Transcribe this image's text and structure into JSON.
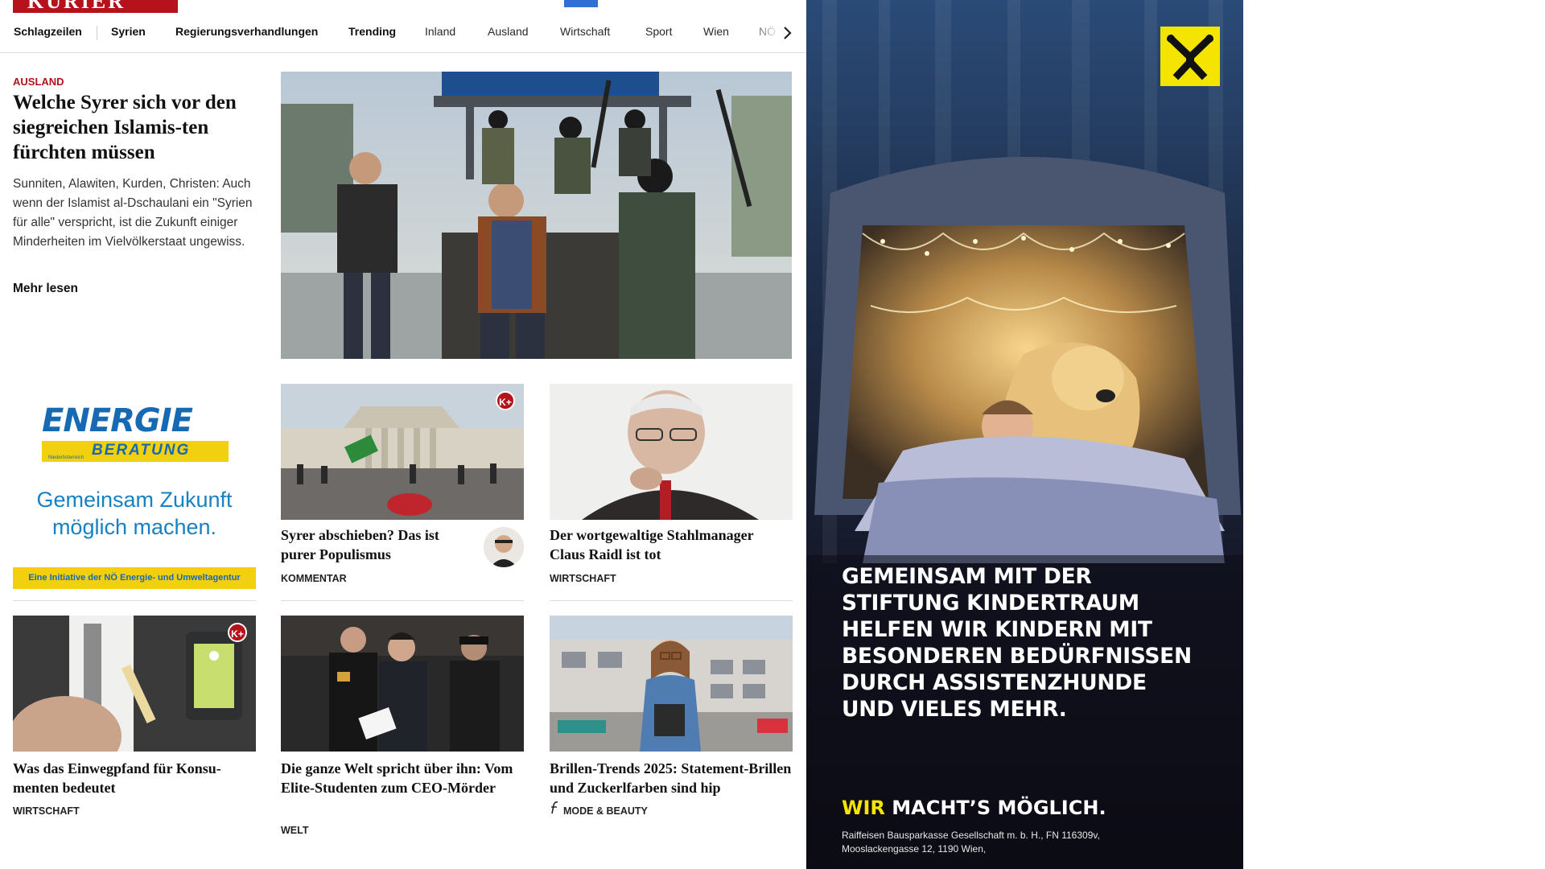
{
  "header": {
    "logo_text": "KURIER",
    "nav": [
      {
        "label": "Schlagzeilen"
      },
      {
        "label": "Syrien"
      },
      {
        "label": "Regierungsverhandlungen"
      },
      {
        "label": "Trending"
      },
      {
        "label": "Inland"
      },
      {
        "label": "Ausland"
      },
      {
        "label": "Wirtschaft"
      },
      {
        "label": "Sport"
      },
      {
        "label": "Wien"
      },
      {
        "label": "NÖ"
      }
    ]
  },
  "lead": {
    "kicker": "AUSLAND",
    "title": "Welche Syrer sich vor den siegreichen Islamis-ten fürchten müssen",
    "teaser": "Sunniten, Alawiten, Kurden, Christen: Auch wenn der Islamist al-Dschaulani ein \"Syrien für alle\" verspricht, ist die Zukunft einiger Minderheiten im Vielvölkerstaat ungewiss.",
    "more": "Mehr lesen"
  },
  "ad_left": {
    "brand": "ENERGIE",
    "brand_sub": "BERATUNG",
    "brand_tiny": "Niederösterreich",
    "slogan_line1": "Gemeinsam Zukunft",
    "slogan_line2": "möglich machen.",
    "band": "Eine Initiative der NÖ Energie- und Umweltagentur"
  },
  "cards": [
    {
      "title": "Syrer abschieben? Das ist purer Populismus",
      "category": "KOMMENTAR",
      "badge": "K+"
    },
    {
      "title": "Der wortgewaltige Stahlmanager Claus Raidl ist tot",
      "category": "WIRTSCHAFT"
    },
    {
      "title": "Was das Einwegpfand für Konsu-menten bedeutet",
      "category": "WIRTSCHAFT",
      "badge": "K+"
    },
    {
      "title": "Die ganze Welt spricht über ihn: Vom Elite-Studenten zum CEO-Mörder",
      "category": "WELT"
    },
    {
      "title": "Brillen-Trends 2025: Statement-Brillen und Zuckerlfarben sind hip",
      "category": "MODE & BEAUTY",
      "icon": "fashion-f-icon"
    }
  ],
  "ad_right": {
    "headline": [
      "GEMEINSAM MIT DER",
      "STIFTUNG KINDERTRAUM",
      "HELFEN WIR KINDERN MIT",
      "BESONDEREN BEDÜRFNISSEN",
      "DURCH ASSISTENZHUNDE",
      "UND VIELES MEHR."
    ],
    "claim_highlight": "WIR",
    "claim_rest": " MACHT’S MÖGLICH.",
    "legal_line1": "Raiffeisen Bausparkasse Gesellschaft m. b. H., FN 116309v,",
    "legal_line2": "Mooslackengasse 12, 1190 Wien,",
    "logo_icon": "raiffeisen-gable-icon"
  },
  "colors": {
    "brand_red": "#b5121b",
    "nav_text": "#2a2a2a",
    "ad_yellow": "#f4e400",
    "energie_blue": "#1669b3"
  }
}
